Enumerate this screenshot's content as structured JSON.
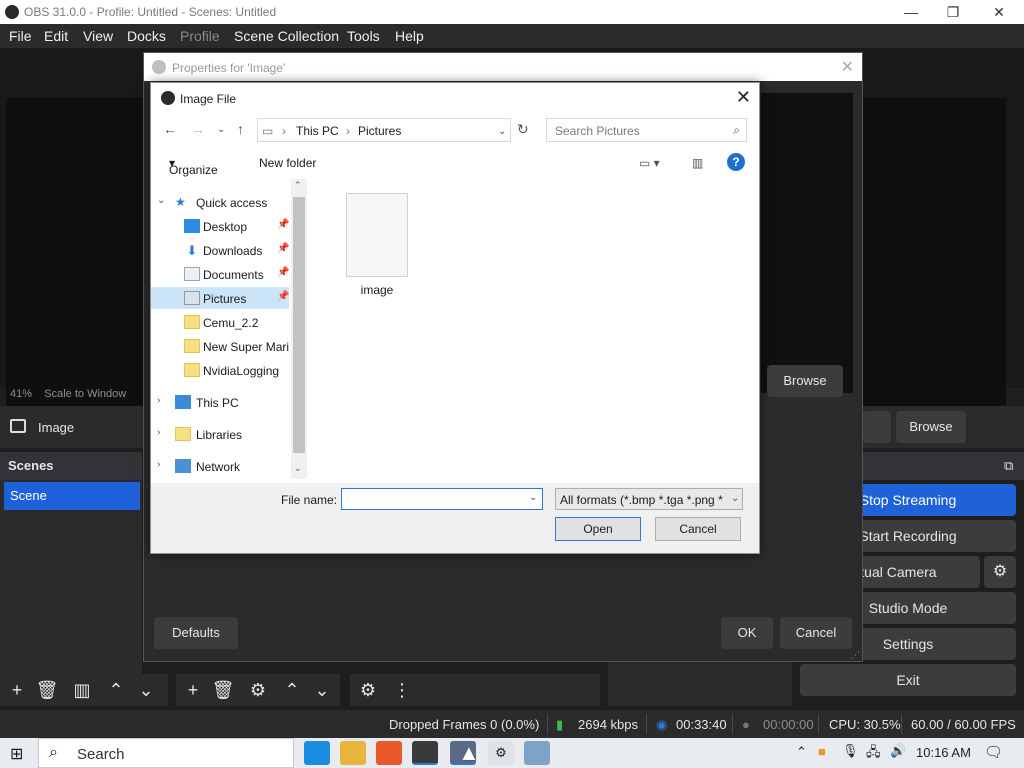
{
  "window": {
    "title": "OBS 31.0.0 - Profile: Untitled - Scenes: Untitled",
    "minimize_glyph": "—",
    "restore_glyph": "❐",
    "close_glyph": "✕"
  },
  "menu": [
    "File",
    "Edit",
    "View",
    "Docks",
    "Profile",
    "Scene Collection",
    "Tools",
    "Help"
  ],
  "preview": {
    "zoom_text": "41%",
    "scale_text": "Scale to Window"
  },
  "source_bar": {
    "source_name": "Image",
    "browse_label": "Browse"
  },
  "properties_dialog": {
    "title": "Properties for 'Image'",
    "browse_label": "Browse",
    "defaults_label": "Defaults",
    "ok_label": "OK",
    "cancel_label": "Cancel"
  },
  "file_dialog": {
    "title": "Image File",
    "breadcrumb": [
      "This PC",
      "Pictures"
    ],
    "search_placeholder": "Search Pictures",
    "organize_label": "Organize",
    "new_folder_label": "New folder",
    "quick_access_label": "Quick access",
    "quick_access_items": [
      {
        "label": "Desktop",
        "icon": "desktop-icon",
        "pinned": true
      },
      {
        "label": "Downloads",
        "icon": "download-icon",
        "pinned": true
      },
      {
        "label": "Documents",
        "icon": "documents-icon",
        "pinned": true
      },
      {
        "label": "Pictures",
        "icon": "pictures-icon",
        "pinned": true,
        "selected": true
      },
      {
        "label": "Cemu_2.2",
        "icon": "folder-icon",
        "pinned": false
      },
      {
        "label": "New Super Mario",
        "icon": "folder-icon",
        "pinned": false
      },
      {
        "label": "NvidiaLogging",
        "icon": "folder-icon",
        "pinned": false
      }
    ],
    "this_pc_label": "This PC",
    "libraries_label": "Libraries",
    "network_label": "Network",
    "files": [
      {
        "name": "image"
      }
    ],
    "file_name_label": "File name:",
    "file_name_value": "",
    "file_type": "All formats (*.bmp *.tga *.png *",
    "open_label": "Open",
    "cancel_label": "Cancel"
  },
  "scenes": {
    "header": "Scenes",
    "items": [
      "Scene"
    ]
  },
  "controls": {
    "stop_streaming": "Stop Streaming",
    "start_recording": "Start Recording",
    "virtual_camera": "Virtual Camera",
    "studio_mode": "Studio Mode",
    "settings": "Settings",
    "exit": "Exit"
  },
  "status": {
    "dropped_frames": "Dropped Frames 0 (0.0%)",
    "bitrate": "2694 kbps",
    "stream_time": "00:33:40",
    "record_time": "00:00:00",
    "cpu": "CPU: 30.5%",
    "fps": "60.00 / 60.00 FPS"
  },
  "taskbar": {
    "search_label": "Search",
    "clock": "10:16 AM"
  },
  "colors": {
    "accent": "#1f61d9",
    "obs_bg": "#2b2a2c",
    "dialog_bg": "#ffffff"
  }
}
